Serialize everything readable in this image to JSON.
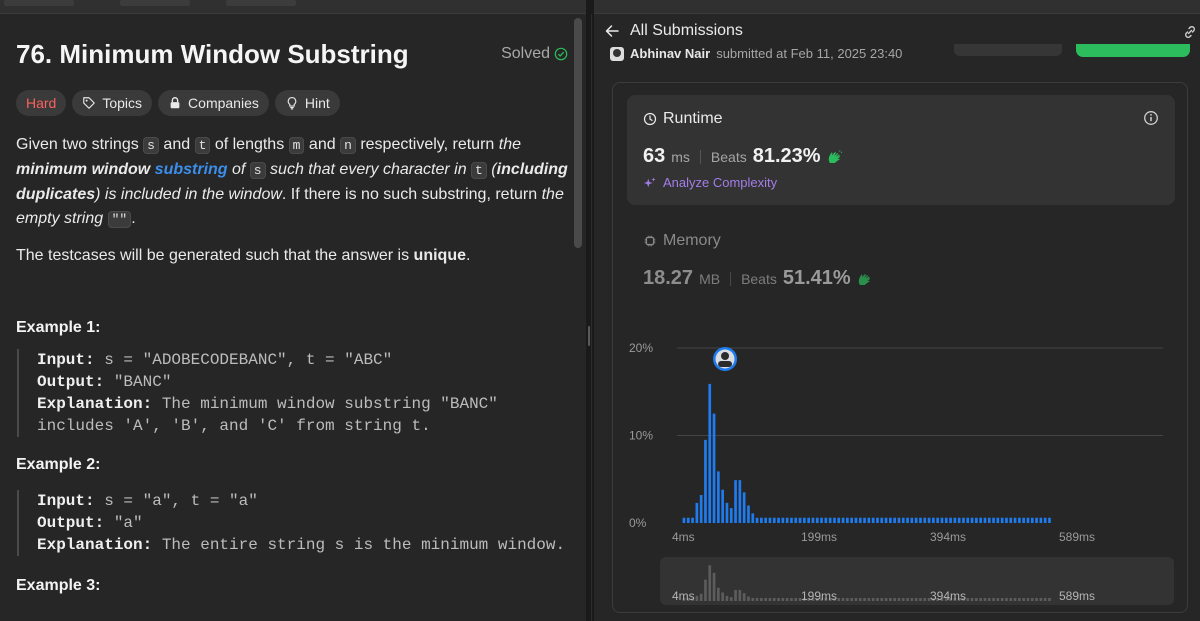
{
  "problem": {
    "title": "76. Minimum Window Substring",
    "status": "Solved",
    "tags": {
      "difficulty": "Hard",
      "topics": "Topics",
      "companies": "Companies",
      "hint": "Hint"
    },
    "desc": {
      "t1": "Given two strings ",
      "c_s": "s",
      "t2": " and ",
      "c_t": "t",
      "t3": " of lengths ",
      "c_m": "m",
      "t4": " and ",
      "c_n": "n",
      "t5": " respectively, return ",
      "i1": "the ",
      "bi1": "minimum window ",
      "link": "substring",
      "i2": " of ",
      "c_s2": "s",
      "i3": " such that every character in ",
      "c_t2": "t",
      "i4": " (",
      "bi2": "including duplicates",
      "i5": ") is included in the window",
      "t6": ". If there is no such substring, return ",
      "i6": "the empty string ",
      "c_empty": "\"\"",
      "t7": "."
    },
    "desc2": {
      "t1": "The testcases will be generated such that the answer is ",
      "b1": "unique",
      "t2": "."
    },
    "examples": [
      {
        "heading": "Example 1:",
        "input_label": "Input:",
        "input": " s = \"ADOBECODEBANC\", t = \"ABC\"",
        "output_label": "Output:",
        "output": " \"BANC\"",
        "expl_label": "Explanation:",
        "expl": " The minimum window substring \"BANC\" includes 'A', 'B', and 'C' from string t."
      },
      {
        "heading": "Example 2:",
        "input_label": "Input:",
        "input": " s = \"a\", t = \"a\"",
        "output_label": "Output:",
        "output": " \"a\"",
        "expl_label": "Explanation:",
        "expl": " The entire string s is the minimum window."
      },
      {
        "heading": "Example 3:"
      }
    ]
  },
  "submission": {
    "back_label": "All Submissions",
    "user": "Abhinav Nair",
    "submitted_text": "submitted at Feb 11, 2025 23:40",
    "runtime": {
      "label": "Runtime",
      "value": "63",
      "unit": "ms",
      "beats_label": "Beats",
      "beats": "81.23%"
    },
    "analyze_label": "Analyze Complexity",
    "memory": {
      "label": "Memory",
      "value": "18.27",
      "unit": "MB",
      "beats_label": "Beats",
      "beats": "51.41%"
    }
  },
  "colors": {
    "accent_blue": "#1e7cf0",
    "success_green": "#2cbb5d",
    "hard_red": "#f8615c",
    "analyze_purple": "#a47de8"
  },
  "chart_data": {
    "type": "bar",
    "ylabel": "",
    "xlabel": "",
    "y_ticks": [
      "0%",
      "10%",
      "20%"
    ],
    "ylim": [
      0,
      20
    ],
    "x_ticks": [
      "4ms",
      "199ms",
      "394ms",
      "589ms"
    ],
    "x_tick_values": [
      4,
      199,
      394,
      589
    ],
    "bin_width": 6.5,
    "highlight_x": 63,
    "grid": true,
    "values": [
      0.6,
      0.6,
      0.6,
      2.3,
      3.2,
      9.5,
      15.9,
      12.5,
      5.9,
      3.8,
      2.3,
      1.7,
      4.9,
      4.9,
      3.5,
      2.0,
      1.1,
      0.6,
      0.6,
      0.6,
      0.6,
      0.6,
      0.6,
      0.6,
      0.6,
      0.6,
      0.6,
      0.6,
      0.6,
      0.6,
      0.6,
      0.6,
      0.6,
      0.6,
      0.6,
      0.6,
      0.6,
      0.6,
      0.6,
      0.6,
      0.6,
      0.6,
      0.6,
      0.6,
      0.6,
      0.6,
      0.6,
      0.6,
      0.6,
      0.6,
      0.6,
      0.6,
      0.6,
      0.6,
      0.6,
      0.6,
      0.6,
      0.6,
      0.6,
      0.6,
      0.6,
      0.6,
      0.6,
      0.6,
      0.6,
      0.6,
      0.6,
      0.6,
      0.6,
      0.6,
      0.6,
      0.6,
      0.6,
      0.6,
      0.6,
      0.6,
      0.6,
      0.6,
      0.6,
      0.6,
      0.6,
      0.6,
      0.6,
      0.6,
      0.6,
      0.6
    ]
  }
}
